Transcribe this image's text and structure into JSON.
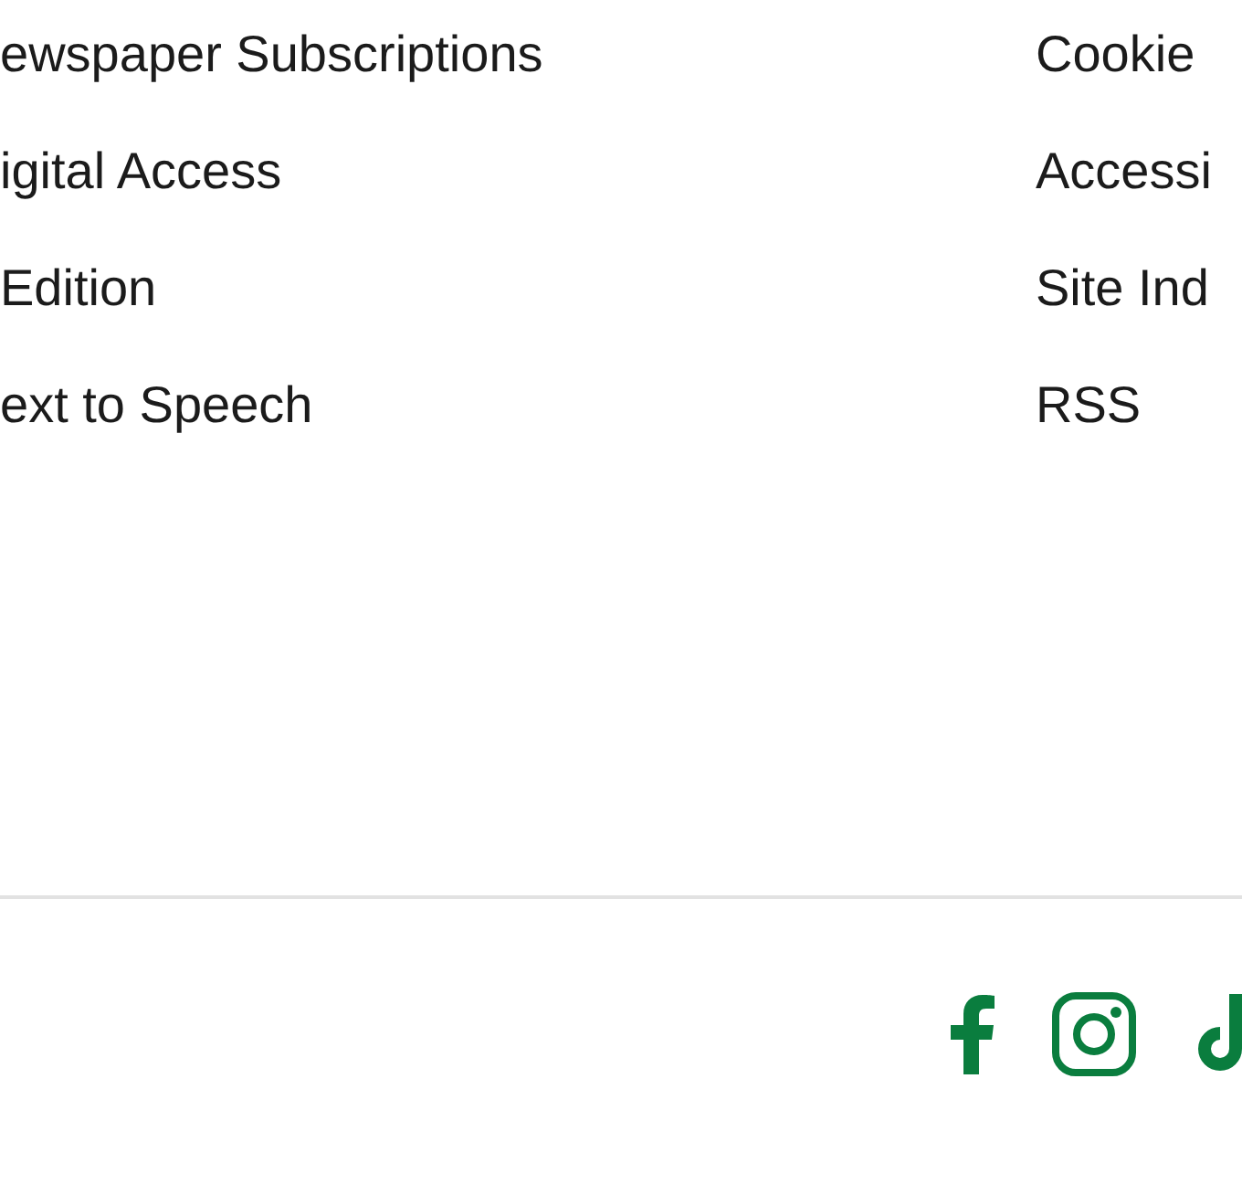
{
  "footer": {
    "columns": [
      {
        "links": [
          "ewspaper Subscriptions",
          "igital Access",
          "Edition",
          "ext to Speech"
        ]
      },
      {
        "links": [
          "Cookie",
          "Accessi",
          "Site Ind",
          "RSS"
        ]
      }
    ]
  }
}
